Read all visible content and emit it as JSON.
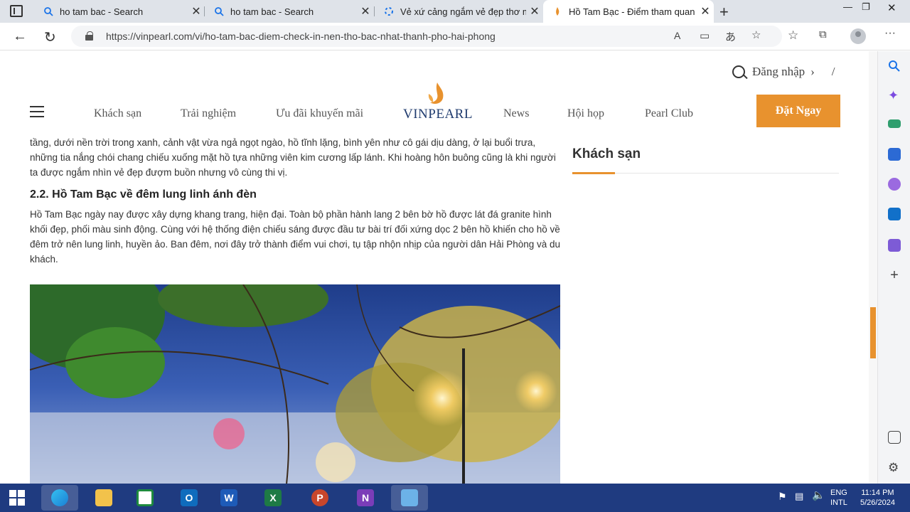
{
  "browser": {
    "tabs": [
      {
        "title": "ho tam bac - Search",
        "icon": "search-icon",
        "active": false
      },
      {
        "title": "ho tam bac - Search",
        "icon": "search-icon",
        "active": false
      },
      {
        "title": "Vẻ xứ cảng ngắm vẻ đẹp thơ mộ",
        "icon": "loading-icon",
        "active": false
      },
      {
        "title": "Hồ Tam Bạc - Điểm tham quan n",
        "icon": "vinpearl-favicon",
        "active": true
      }
    ],
    "url": "https://vinpearl.com/vi/ho-tam-bac-diem-check-in-nen-tho-bac-nhat-thanh-pho-hai-phong"
  },
  "site": {
    "login_label": "Đăng nhập",
    "lang_sep": "/",
    "nav": [
      "Khách sạn",
      "Trải nghiệm",
      "Ưu đãi khuyến mãi",
      "News",
      "Hội họp",
      "Pearl Club"
    ],
    "logo_text": "VINPEARL",
    "book_label": "Đặt Ngay",
    "brand_color": "#e8922e"
  },
  "article": {
    "para1": "tầng, dưới nền trời trong xanh, cảnh vật vừa ngả ngọt ngào, hồ tĩnh lặng, bình yên như cô gái dịu dàng, ở lại buổi trưa, những tia nắng chói chang chiếu xuống mặt hồ tựa những viên kim cương lấp lánh. Khi hoàng hôn buông cũng là khi người ta được ngắm nhìn vẻ đẹp đượm buồn nhưng vô cùng thi vị.",
    "heading": "2.2. Hồ Tam Bạc về đêm lung linh ánh đèn",
    "para2": "Hồ Tam Bạc ngày nay được xây dựng khang trang, hiện đại. Toàn bộ phần hành lang 2 bên bờ hồ được lát đá granite hình khối đẹp, phối màu sinh động. Cùng với hệ thống điện chiếu sáng được đầu tư bài trí đối xứng dọc 2 bên hồ khiến cho hồ về đêm trở nên lung linh, huyền ảo. Ban đêm, nơi đây trở thành điểm vui chơi, tụ tập nhộn nhịp của người dân Hải Phòng và du khách."
  },
  "sidebar": {
    "title": "Khách sạn"
  },
  "taskbar": {
    "lang1": "ENG",
    "lang2": "INTL",
    "time": "11:14 PM",
    "date": "5/26/2024"
  }
}
